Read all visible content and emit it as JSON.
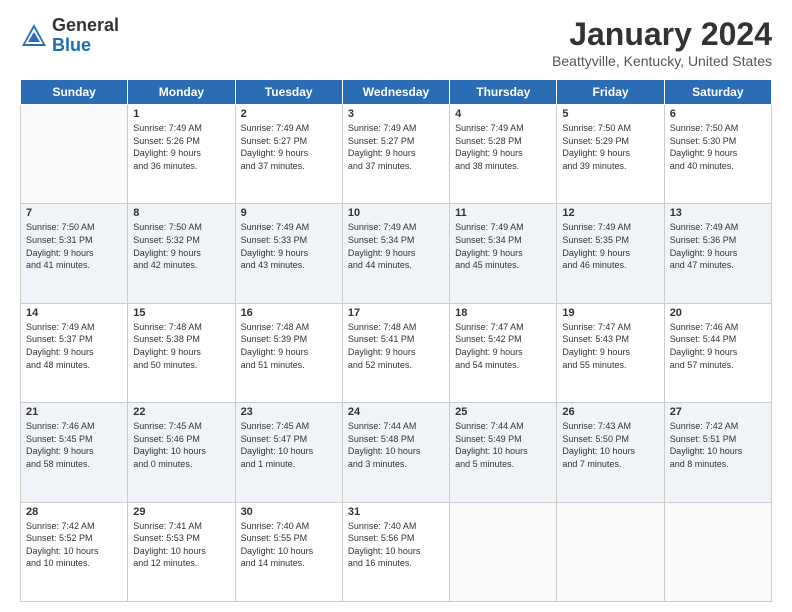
{
  "header": {
    "logo_general": "General",
    "logo_blue": "Blue",
    "month_year": "January 2024",
    "location": "Beattyville, Kentucky, United States"
  },
  "days_of_week": [
    "Sunday",
    "Monday",
    "Tuesday",
    "Wednesday",
    "Thursday",
    "Friday",
    "Saturday"
  ],
  "weeks": [
    [
      {
        "day": "",
        "info": ""
      },
      {
        "day": "1",
        "info": "Sunrise: 7:49 AM\nSunset: 5:26 PM\nDaylight: 9 hours\nand 36 minutes."
      },
      {
        "day": "2",
        "info": "Sunrise: 7:49 AM\nSunset: 5:27 PM\nDaylight: 9 hours\nand 37 minutes."
      },
      {
        "day": "3",
        "info": "Sunrise: 7:49 AM\nSunset: 5:27 PM\nDaylight: 9 hours\nand 37 minutes."
      },
      {
        "day": "4",
        "info": "Sunrise: 7:49 AM\nSunset: 5:28 PM\nDaylight: 9 hours\nand 38 minutes."
      },
      {
        "day": "5",
        "info": "Sunrise: 7:50 AM\nSunset: 5:29 PM\nDaylight: 9 hours\nand 39 minutes."
      },
      {
        "day": "6",
        "info": "Sunrise: 7:50 AM\nSunset: 5:30 PM\nDaylight: 9 hours\nand 40 minutes."
      }
    ],
    [
      {
        "day": "7",
        "info": "Sunrise: 7:50 AM\nSunset: 5:31 PM\nDaylight: 9 hours\nand 41 minutes."
      },
      {
        "day": "8",
        "info": "Sunrise: 7:50 AM\nSunset: 5:32 PM\nDaylight: 9 hours\nand 42 minutes."
      },
      {
        "day": "9",
        "info": "Sunrise: 7:49 AM\nSunset: 5:33 PM\nDaylight: 9 hours\nand 43 minutes."
      },
      {
        "day": "10",
        "info": "Sunrise: 7:49 AM\nSunset: 5:34 PM\nDaylight: 9 hours\nand 44 minutes."
      },
      {
        "day": "11",
        "info": "Sunrise: 7:49 AM\nSunset: 5:34 PM\nDaylight: 9 hours\nand 45 minutes."
      },
      {
        "day": "12",
        "info": "Sunrise: 7:49 AM\nSunset: 5:35 PM\nDaylight: 9 hours\nand 46 minutes."
      },
      {
        "day": "13",
        "info": "Sunrise: 7:49 AM\nSunset: 5:36 PM\nDaylight: 9 hours\nand 47 minutes."
      }
    ],
    [
      {
        "day": "14",
        "info": "Sunrise: 7:49 AM\nSunset: 5:37 PM\nDaylight: 9 hours\nand 48 minutes."
      },
      {
        "day": "15",
        "info": "Sunrise: 7:48 AM\nSunset: 5:38 PM\nDaylight: 9 hours\nand 50 minutes."
      },
      {
        "day": "16",
        "info": "Sunrise: 7:48 AM\nSunset: 5:39 PM\nDaylight: 9 hours\nand 51 minutes."
      },
      {
        "day": "17",
        "info": "Sunrise: 7:48 AM\nSunset: 5:41 PM\nDaylight: 9 hours\nand 52 minutes."
      },
      {
        "day": "18",
        "info": "Sunrise: 7:47 AM\nSunset: 5:42 PM\nDaylight: 9 hours\nand 54 minutes."
      },
      {
        "day": "19",
        "info": "Sunrise: 7:47 AM\nSunset: 5:43 PM\nDaylight: 9 hours\nand 55 minutes."
      },
      {
        "day": "20",
        "info": "Sunrise: 7:46 AM\nSunset: 5:44 PM\nDaylight: 9 hours\nand 57 minutes."
      }
    ],
    [
      {
        "day": "21",
        "info": "Sunrise: 7:46 AM\nSunset: 5:45 PM\nDaylight: 9 hours\nand 58 minutes."
      },
      {
        "day": "22",
        "info": "Sunrise: 7:45 AM\nSunset: 5:46 PM\nDaylight: 10 hours\nand 0 minutes."
      },
      {
        "day": "23",
        "info": "Sunrise: 7:45 AM\nSunset: 5:47 PM\nDaylight: 10 hours\nand 1 minute."
      },
      {
        "day": "24",
        "info": "Sunrise: 7:44 AM\nSunset: 5:48 PM\nDaylight: 10 hours\nand 3 minutes."
      },
      {
        "day": "25",
        "info": "Sunrise: 7:44 AM\nSunset: 5:49 PM\nDaylight: 10 hours\nand 5 minutes."
      },
      {
        "day": "26",
        "info": "Sunrise: 7:43 AM\nSunset: 5:50 PM\nDaylight: 10 hours\nand 7 minutes."
      },
      {
        "day": "27",
        "info": "Sunrise: 7:42 AM\nSunset: 5:51 PM\nDaylight: 10 hours\nand 8 minutes."
      }
    ],
    [
      {
        "day": "28",
        "info": "Sunrise: 7:42 AM\nSunset: 5:52 PM\nDaylight: 10 hours\nand 10 minutes."
      },
      {
        "day": "29",
        "info": "Sunrise: 7:41 AM\nSunset: 5:53 PM\nDaylight: 10 hours\nand 12 minutes."
      },
      {
        "day": "30",
        "info": "Sunrise: 7:40 AM\nSunset: 5:55 PM\nDaylight: 10 hours\nand 14 minutes."
      },
      {
        "day": "31",
        "info": "Sunrise: 7:40 AM\nSunset: 5:56 PM\nDaylight: 10 hours\nand 16 minutes."
      },
      {
        "day": "",
        "info": ""
      },
      {
        "day": "",
        "info": ""
      },
      {
        "day": "",
        "info": ""
      }
    ]
  ]
}
